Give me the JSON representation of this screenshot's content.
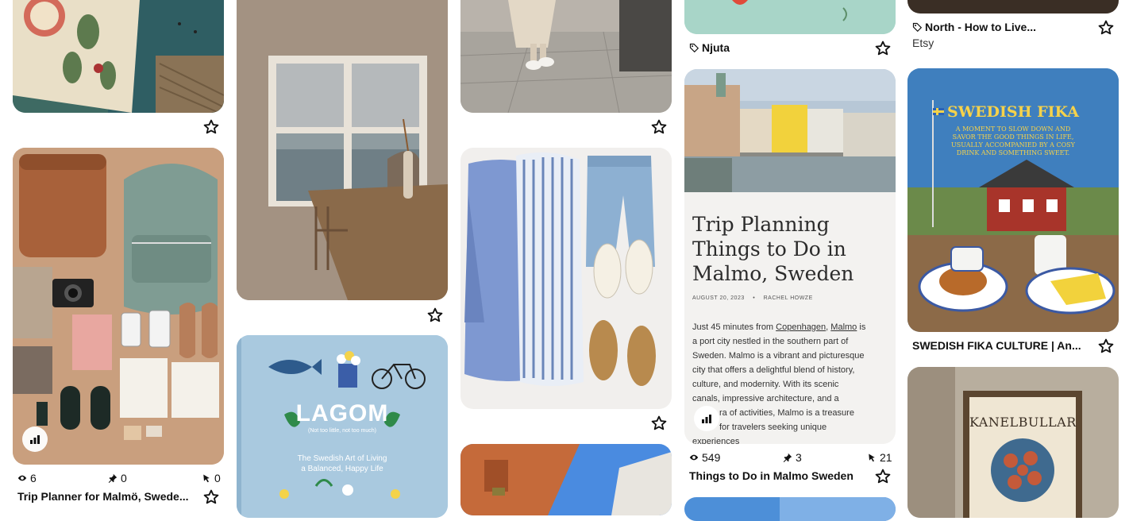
{
  "pins": {
    "c1_top": {},
    "c1_trip": {
      "views": "6",
      "saves": "0",
      "clicks": "0",
      "title": "Trip Planner for Malmö, Swede..."
    },
    "c3_outfit": {},
    "c2_lagom": {
      "title": "LAGOM",
      "subtitle": "(Not too little, not too much)",
      "tagline1": "The Swedish Art of Living",
      "tagline2": "a Balanced, Happy Life"
    },
    "c4_njuta": {
      "title": "Njuta"
    },
    "c4_malmo": {
      "heading1": "Trip Planning",
      "heading2": "Things to Do in",
      "heading3": "Malmo, Sweden",
      "date": "AUGUST 20, 2023",
      "author": "RACHEL HOWZE",
      "body_pre": "Just 45 minutes from ",
      "link1": "Copenhagen",
      "comma": ", ",
      "link2": "Malmo",
      "body_post1": " is",
      "body2": "a port city nestled in the southern part of",
      "body3": "Sweden. Malmo is a vibrant and picturesque",
      "body4": "city that offers a delightful blend of history,",
      "body5": "culture, and modernity. With its scenic",
      "body6": "canals, impressive architecture, and a",
      "body7": "ra of activities, Malmo is a treasure",
      "body8": "for travelers seeking unique",
      "body9": "experiences",
      "views": "549",
      "saves": "3",
      "clicks": "21",
      "title": "Things to Do in Malmo Sweden"
    },
    "c5_north": {
      "title": "North - How to Live...",
      "source": "Etsy"
    },
    "c5_fika": {
      "heading": "SWEDISH FIKA",
      "line1": "A MOMENT TO SLOW DOWN AND",
      "line2": "SAVOR THE GOOD THINGS IN LIFE,",
      "line3": "USUALLY ACCOMPANIED BY A COSY",
      "line4": "DRINK AND SOMETHING SWEET.",
      "title": "SWEDISH FIKA CULTURE | An..."
    },
    "c5_kanel": {
      "poster_title": "KANELBULLAR"
    }
  },
  "colors": {
    "star": "#111111",
    "lagom_bg": "#a9c9df",
    "njuta_bg": "#a8d5c8",
    "link": "#1a1a1a"
  }
}
